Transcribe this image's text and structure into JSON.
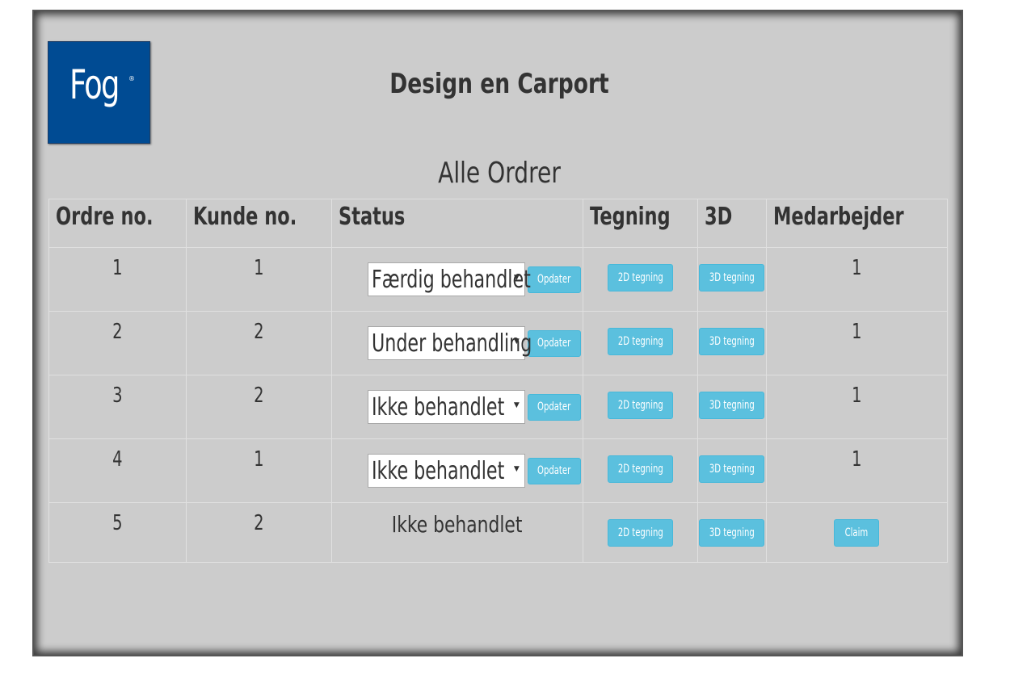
{
  "header": {
    "logo_text": "Fog",
    "logo_reg": "®",
    "title": "Design en Carport"
  },
  "section_title": "Alle Ordrer",
  "table": {
    "columns": [
      "Ordre no.",
      "Kunde no.",
      "Status",
      "Tegning",
      "3D",
      "Medarbejder"
    ],
    "rows": [
      {
        "order": "1",
        "customer": "1",
        "status": "Færdig behandlet",
        "editable": true,
        "update_label": "Opdater",
        "drawing_2d": "2D tegning",
        "drawing_3d": "3D tegning",
        "employee": "1"
      },
      {
        "order": "2",
        "customer": "2",
        "status": "Under behandling",
        "editable": true,
        "update_label": "Opdater",
        "drawing_2d": "2D tegning",
        "drawing_3d": "3D tegning",
        "employee": "1"
      },
      {
        "order": "3",
        "customer": "2",
        "status": "Ikke behandlet",
        "editable": true,
        "update_label": "Opdater",
        "drawing_2d": "2D tegning",
        "drawing_3d": "3D tegning",
        "employee": "1"
      },
      {
        "order": "4",
        "customer": "1",
        "status": "Ikke behandlet",
        "editable": true,
        "update_label": "Opdater",
        "drawing_2d": "2D tegning",
        "drawing_3d": "3D tegning",
        "employee": "1"
      },
      {
        "order": "5",
        "customer": "2",
        "status": "Ikke behandlet",
        "editable": false,
        "drawing_2d": "2D tegning",
        "drawing_3d": "3D tegning",
        "claim_label": "Claim"
      }
    ]
  },
  "colors": {
    "background": "#cccccc",
    "logo_blue": "#004b93",
    "button_info": "#5bc0de",
    "text": "#333333"
  }
}
